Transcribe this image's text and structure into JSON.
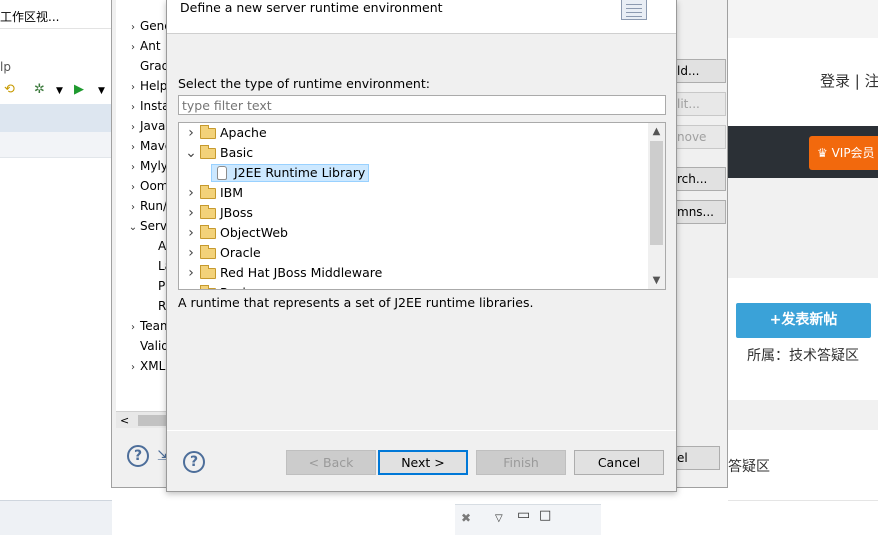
{
  "eclipse": {
    "window_title_fragment": "工作区视...",
    "menu_help": "lp",
    "bottom_strip_labels": [
      "",
      ""
    ]
  },
  "preferences": {
    "tree_items": [
      {
        "label": "General",
        "expanded": false
      },
      {
        "label": "Ant",
        "expanded": false
      },
      {
        "label": "Gradle",
        "expanded": null
      },
      {
        "label": "Help",
        "expanded": false
      },
      {
        "label": "Install/Update",
        "expanded": false
      },
      {
        "label": "Java",
        "expanded": false
      },
      {
        "label": "Maven",
        "expanded": false
      },
      {
        "label": "Mylyn",
        "expanded": false
      },
      {
        "label": "Oomph",
        "expanded": false
      },
      {
        "label": "Run/Debug",
        "expanded": false
      },
      {
        "label": "Server",
        "expanded": true
      },
      {
        "label": "Audio",
        "expanded": null,
        "indent": 1
      },
      {
        "label": "Launching",
        "expanded": null,
        "indent": 1
      },
      {
        "label": "Profilers",
        "expanded": null,
        "indent": 1
      },
      {
        "label": "Runtime Environments",
        "expanded": null,
        "indent": 1
      },
      {
        "label": "Team",
        "expanded": false
      },
      {
        "label": "Validation",
        "expanded": null
      },
      {
        "label": "XML",
        "expanded": false
      }
    ],
    "right_buttons": [
      {
        "label": "Add...",
        "visible": "ld...",
        "disabled": false
      },
      {
        "label": "Edit...",
        "visible": "lit...",
        "disabled": true
      },
      {
        "label": "Remove",
        "visible": "nove",
        "disabled": true
      },
      {
        "label": "Search...",
        "visible": "rch...",
        "disabled": false
      },
      {
        "label": "Columns...",
        "visible": "mns...",
        "disabled": false
      }
    ],
    "cancel_label": "el"
  },
  "wizard": {
    "banner_description": "Define a new server runtime environment",
    "select_label": "Select the type of runtime environment:",
    "filter_placeholder": "type filter text",
    "tree": [
      {
        "label": "Apache",
        "type": "folder",
        "expanded": false
      },
      {
        "label": "Basic",
        "type": "folder",
        "expanded": true
      },
      {
        "label": "J2EE Runtime Library",
        "type": "runtime",
        "selected": true
      },
      {
        "label": "IBM",
        "type": "folder",
        "expanded": false
      },
      {
        "label": "JBoss",
        "type": "folder",
        "expanded": false
      },
      {
        "label": "ObjectWeb",
        "type": "folder",
        "expanded": false
      },
      {
        "label": "Oracle",
        "type": "folder",
        "expanded": false
      },
      {
        "label": "Red Hat JBoss Middleware",
        "type": "folder",
        "expanded": false
      },
      {
        "label": "Resin",
        "type": "folder",
        "expanded": false
      }
    ],
    "description": "A runtime that represents a set of J2EE runtime libraries.",
    "buttons": {
      "back": "< Back",
      "next": "Next >",
      "finish": "Finish",
      "cancel": "Cancel"
    }
  },
  "web": {
    "login": "登录 | 注",
    "vip_label": "♛ VIP会员",
    "post_button": "+发表新帖",
    "belongs_to": "所属：技术答疑区",
    "section_fragment": "答疑区"
  },
  "icons": {
    "help": "question-circle-icon",
    "folder": "folder-icon",
    "jar": "jar-icon",
    "expand": "chevron-right-icon",
    "collapse": "chevron-down-icon"
  }
}
